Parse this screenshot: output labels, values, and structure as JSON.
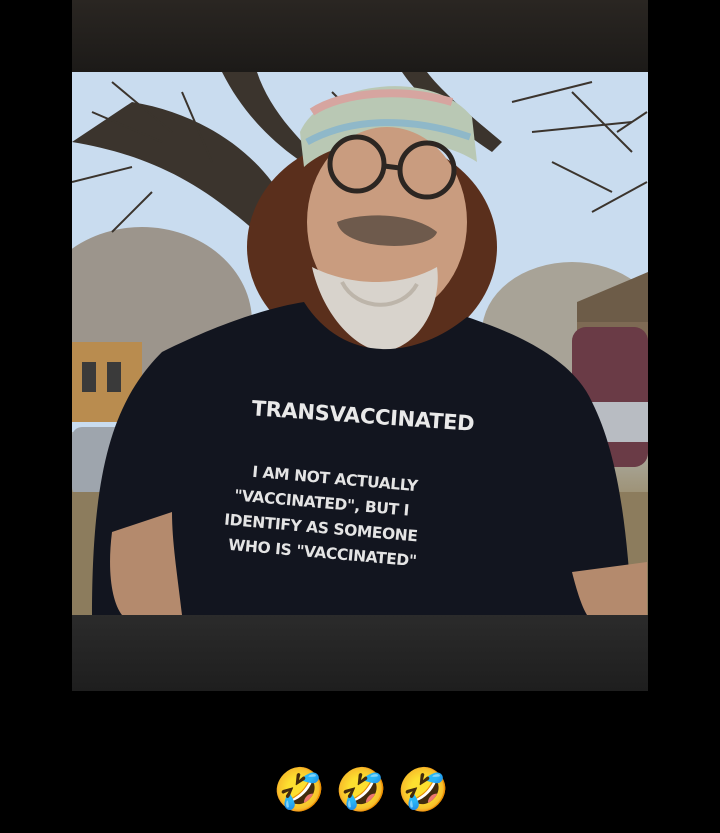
{
  "photo": {
    "shirt_headline": "TRANSVACCINATED",
    "shirt_lines": [
      "I AM NOT ACTUALLY",
      "\"VACCINATED\", BUT I",
      "IDENTIFY AS SOMEONE",
      "WHO IS \"VACCINATED\""
    ]
  },
  "reactions": {
    "emojis": [
      "🤣",
      "🤣",
      "🤣"
    ],
    "icon": "rolling-on-the-floor-laughing-icon"
  }
}
